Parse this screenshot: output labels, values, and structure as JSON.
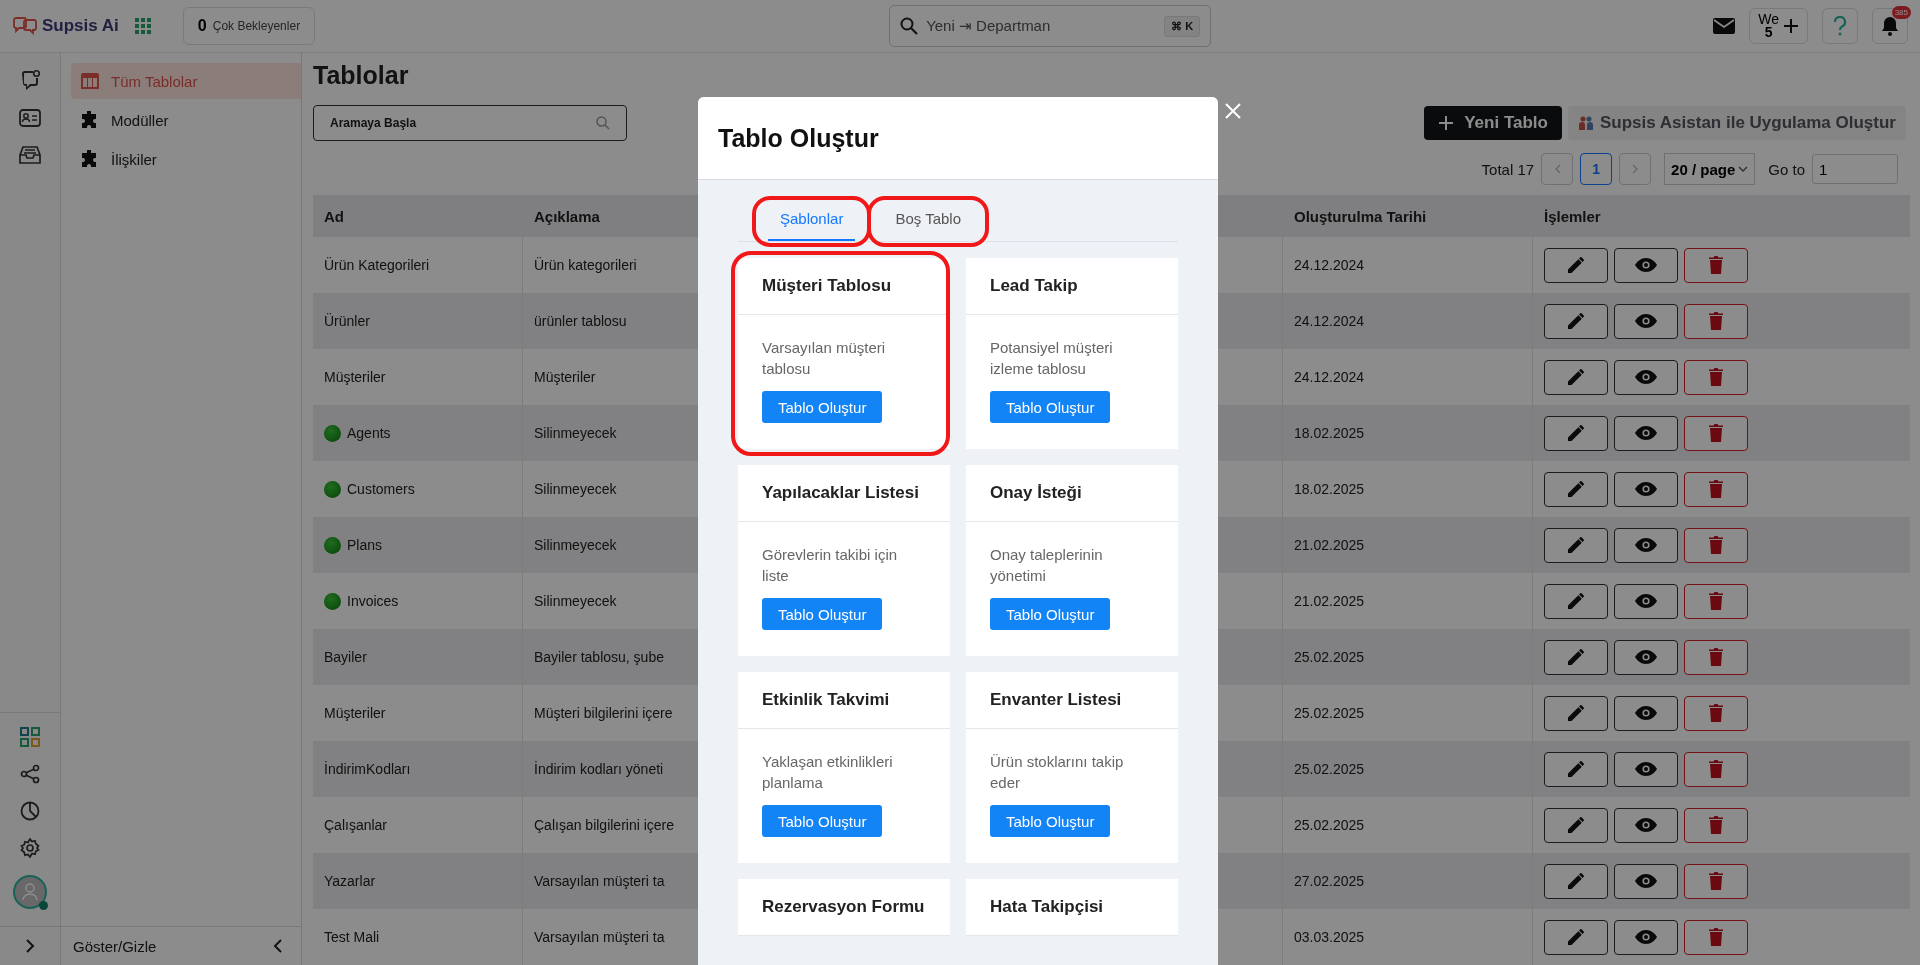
{
  "topbar": {
    "brand": "Supsis Ai",
    "pending": {
      "count": "0",
      "label": "Çok Bekleyenler"
    },
    "search": {
      "value": "Yeni ⇥ Departman",
      "shortcut": "⌘ K"
    },
    "user": {
      "initials": "We",
      "count": "5"
    },
    "notifications": "385"
  },
  "sidebar": {
    "items": [
      {
        "label": "Tüm Tablolar",
        "selected": true
      },
      {
        "label": "Modüller",
        "selected": false
      },
      {
        "label": "İlişkiler",
        "selected": false
      }
    ],
    "toggle": "Göster/Gizle"
  },
  "page": {
    "title": "Tablolar",
    "search_placeholder": "Aramaya Başla",
    "new_button": "Yeni Tablo",
    "assistant_button": "Supsis Asistan ile Uygulama Oluştur"
  },
  "pagination": {
    "total": "Total 17",
    "pages": [
      {
        "label": "1",
        "selected": true
      }
    ],
    "page_size": "20 / page",
    "goto_label": "Go to",
    "goto_value": "1"
  },
  "table": {
    "columns": [
      "Ad",
      "Açıklama",
      "Oluşturulma Tarihi",
      "İşlemler"
    ],
    "rows": [
      {
        "name": "Ürün Kategorileri",
        "status_dot": false,
        "description": "Ürün kategorileri",
        "date": "24.12.2024"
      },
      {
        "name": "Ürünler",
        "status_dot": false,
        "description": "ürünler tablosu",
        "date": "24.12.2024"
      },
      {
        "name": "Müşteriler",
        "status_dot": false,
        "description": "Müşteriler",
        "date": "24.12.2024"
      },
      {
        "name": "Agents",
        "status_dot": true,
        "description": "Silinmeyecek",
        "date": "18.02.2025"
      },
      {
        "name": "Customers",
        "status_dot": true,
        "description": "Silinmeyecek",
        "date": "18.02.2025"
      },
      {
        "name": "Plans",
        "status_dot": true,
        "description": "Silinmeyecek",
        "date": "21.02.2025"
      },
      {
        "name": "Invoices",
        "status_dot": true,
        "description": "Silinmeyecek",
        "date": "21.02.2025"
      },
      {
        "name": "Bayiler",
        "status_dot": false,
        "description": "Bayiler tablosu, şube",
        "date": "25.02.2025"
      },
      {
        "name": "Müşteriler",
        "status_dot": false,
        "description": "Müşteri bilgilerini içere",
        "date": "25.02.2025"
      },
      {
        "name": "İndirimKodları",
        "status_dot": false,
        "description": "İndirim kodları yöneti",
        "date": "25.02.2025"
      },
      {
        "name": "Çalışanlar",
        "status_dot": false,
        "description": "Çalışan bilgilerini içere",
        "date": "25.02.2025"
      },
      {
        "name": "Yazarlar",
        "status_dot": false,
        "description": "Varsayılan müşteri ta",
        "date": "27.02.2025"
      },
      {
        "name": "Test Mali",
        "status_dot": false,
        "description": "Varsayılan müşteri ta",
        "date": "03.03.2025"
      }
    ]
  },
  "modal": {
    "title": "Tablo Oluştur",
    "tabs": [
      {
        "label": "Şablonlar",
        "selected": true,
        "highlighted": true
      },
      {
        "label": "Boş Tablo",
        "selected": false,
        "highlighted": true
      }
    ],
    "templates": [
      {
        "title": "Müşteri Tablosu",
        "description": "Varsayılan müşteri tablosu",
        "button": "Tablo Oluştur",
        "highlighted": true
      },
      {
        "title": "Lead Takip",
        "description": "Potansiyel müşteri izleme tablosu",
        "button": "Tablo Oluştur",
        "highlighted": false
      },
      {
        "title": "Yapılacaklar Listesi",
        "description": "Görevlerin takibi için liste",
        "button": "Tablo Oluştur",
        "highlighted": false
      },
      {
        "title": "Onay İsteği",
        "description": "Onay taleplerinin yönetimi",
        "button": "Tablo Oluştur",
        "highlighted": false
      },
      {
        "title": "Etkinlik Takvimi",
        "description": "Yaklaşan etkinlikleri planlama",
        "button": "Tablo Oluştur",
        "highlighted": false
      },
      {
        "title": "Envanter Listesi",
        "description": "Ürün stoklarını takip eder",
        "button": "Tablo Oluştur",
        "highlighted": false
      },
      {
        "title": "Rezervasyon Formu",
        "highlighted": false
      },
      {
        "title": "Hata Takipçisi",
        "highlighted": false
      }
    ]
  }
}
